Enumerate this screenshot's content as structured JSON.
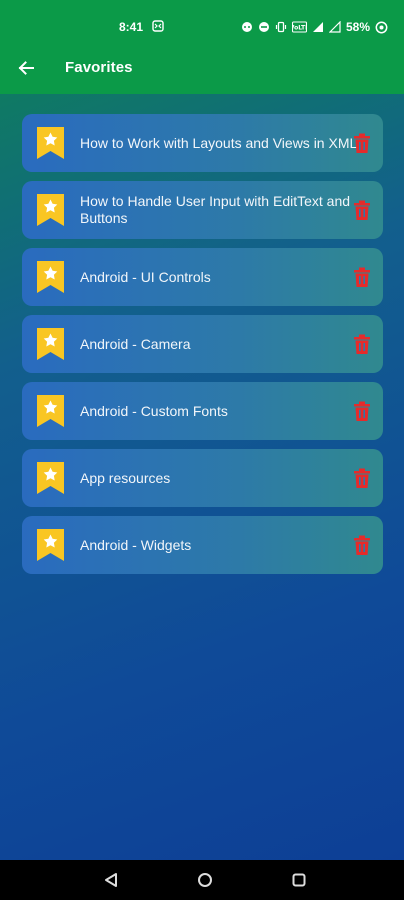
{
  "status_bar": {
    "time": "8:41",
    "battery": "58%"
  },
  "app_bar": {
    "title": "Favorites",
    "back_icon": "arrow-left-icon"
  },
  "favorites": [
    {
      "title": "How to Work with Layouts and Views in XML"
    },
    {
      "title": "How to Handle User Input with EditText and Buttons"
    },
    {
      "title": "Android - UI Controls"
    },
    {
      "title": "Android - Camera"
    },
    {
      "title": "Android - Custom Fonts"
    },
    {
      "title": "App resources"
    },
    {
      "title": "Android - Widgets"
    }
  ],
  "colors": {
    "app_bar": "#0b9a48",
    "bookmark": "#f9c623",
    "delete": "#e52b2b"
  },
  "icons": {
    "bookmark": "bookmark-star-icon",
    "delete": "trash-icon"
  }
}
